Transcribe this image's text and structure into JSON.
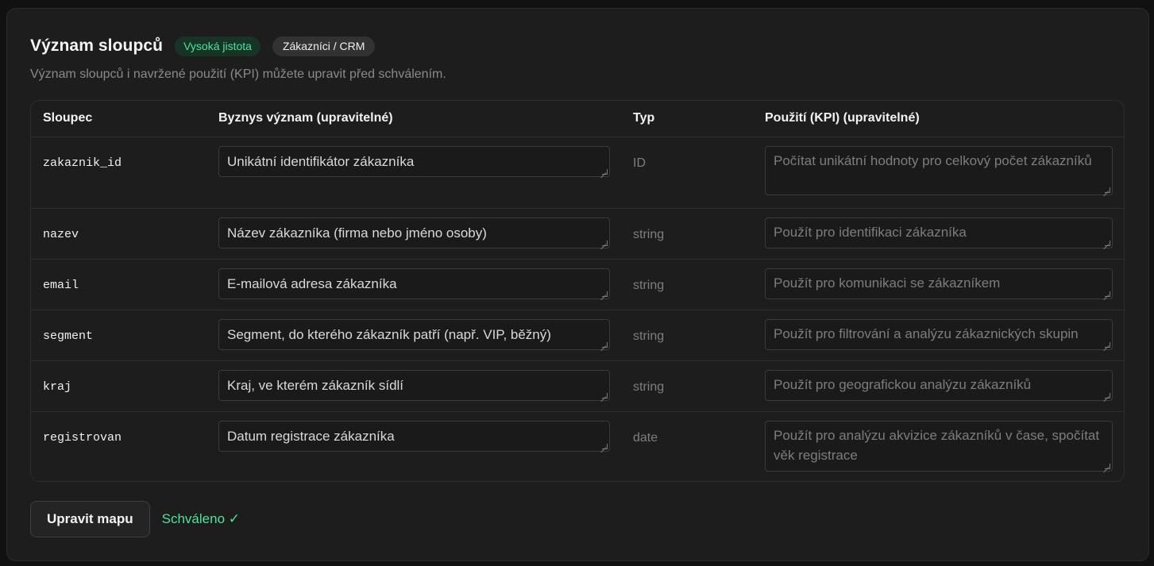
{
  "section": {
    "title": "Význam sloupců",
    "confidence_badge": "Vysoká jistota",
    "dataset_badge": "Zákazníci / CRM",
    "subtitle": "Význam sloupců i navržené použití (KPI) můžete upravit před schválením."
  },
  "table": {
    "headers": {
      "column": "Sloupec",
      "meaning": "Byznys význam (upravitelné)",
      "type": "Typ",
      "kpi": "Použití (KPI) (upravitelné)"
    },
    "rows": [
      {
        "column": "zakaznik_id",
        "meaning": "Unikátní identifikátor zákazníka",
        "type": "ID",
        "kpi": "Počítat unikátní hodnoty pro celkový počet zákazníků"
      },
      {
        "column": "nazev",
        "meaning": "Název zákazníka (firma nebo jméno osoby)",
        "type": "string",
        "kpi": "Použít pro identifikaci zákazníka"
      },
      {
        "column": "email",
        "meaning": "E-mailová adresa zákazníka",
        "type": "string",
        "kpi": "Použít pro komunikaci se zákazníkem"
      },
      {
        "column": "segment",
        "meaning": "Segment, do kterého zákazník patří (např. VIP, běžný)",
        "type": "string",
        "kpi": "Použít pro filtrování a analýzu zákaznických skupin"
      },
      {
        "column": "kraj",
        "meaning": "Kraj, ve kterém zákazník sídlí",
        "type": "string",
        "kpi": "Použít pro geografickou analýzu zákazníků"
      },
      {
        "column": "registrovan",
        "meaning": "Datum registrace zákazníka",
        "type": "date",
        "kpi": "Použít pro analýzu akvizice zákazníků v čase, spočítat věk registrace"
      }
    ]
  },
  "footer": {
    "edit_button": "Upravit mapu",
    "status": "Schváleno ✓"
  },
  "colors": {
    "accent_green": "#4ee39a",
    "card_bg": "#1d1d1d"
  }
}
